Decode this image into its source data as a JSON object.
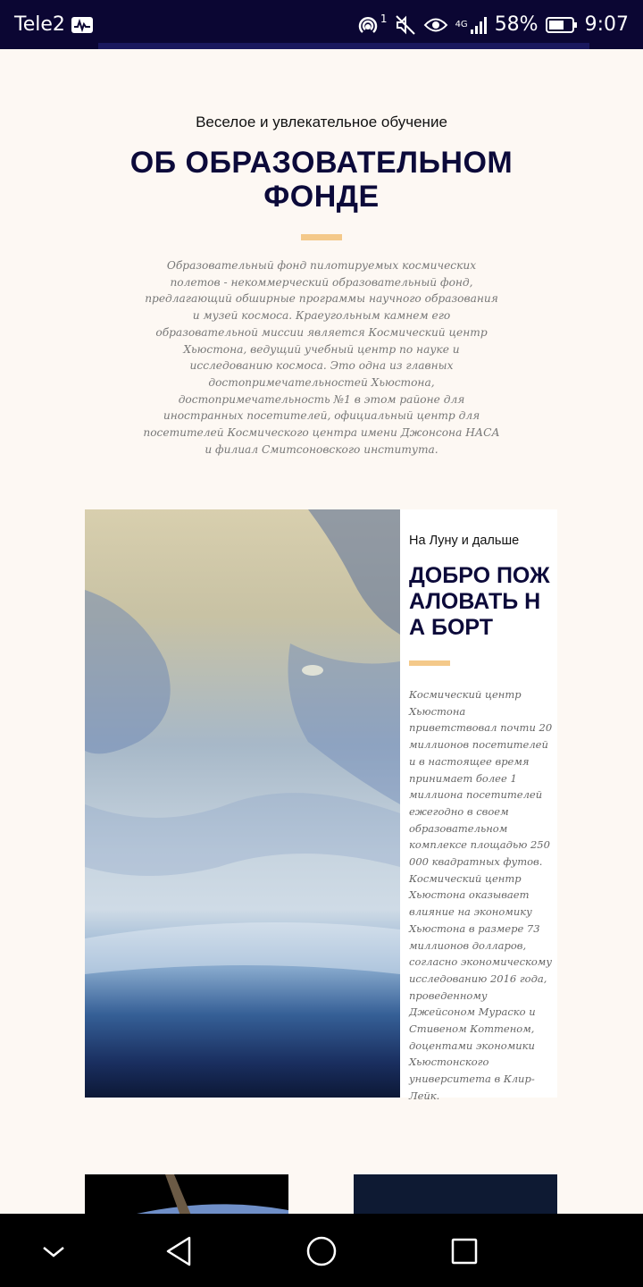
{
  "status_bar": {
    "carrier": "Tele2",
    "signal_sup": "1",
    "network": "4G",
    "battery": "58%",
    "time": "9:07"
  },
  "about": {
    "eyebrow": "Веселое и увлекательное обучение",
    "title": "ОБ ОБРАЗОВАТЕЛЬНОМ ФОНДЕ",
    "description": "Образовательный фонд пилотируемых космических полетов - некоммерческий образовательный фонд, предлагающий обширные программы научного образования и музей космоса. Краеугольным камнем его образовательной миссии является Космический центр Хьюстона, ведущий учебный центр по науке и исследованию космоса. Это одна из главных достопримечательностей Хьюстона, достопримечательность №1 в этом районе для иностранных посетителей, официальный центр для посетителей Космического центра имени Джонсона НАСА и филиал Смитсоновского института."
  },
  "welcome": {
    "eyebrow": "На Луну и дальше",
    "title": "ДОБРО ПОЖАЛОВАТЬ НА БОРТ",
    "description": "Космический центр Хьюстона приветствовал почти 20 миллионов посетителей и в настоящее время принимает более 1 миллиона посетителей ежегодно в своем образовательном комплексе площадью 250 000 квадратных футов. Космический центр Хьюстона оказывает влияние на экономику Хьюстона в размере 73 миллионов долларов, согласно экономическому исследованию 2016 года, проведенному Джейсоном Мураско и Стивеном Коттеном, доцентами экономики Хьюстонского университета в Клир-Лейк."
  },
  "colors": {
    "status_bg": "#0b0633",
    "page_bg": "#fdf8f3",
    "title": "#0c0a3a",
    "accent": "#f4c98a"
  },
  "icons": [
    "activity-icon",
    "hotspot-icon",
    "mute-icon",
    "eye-icon",
    "signal-icon",
    "battery-icon",
    "back-chevron-icon",
    "back-icon",
    "home-icon",
    "recents-icon"
  ]
}
